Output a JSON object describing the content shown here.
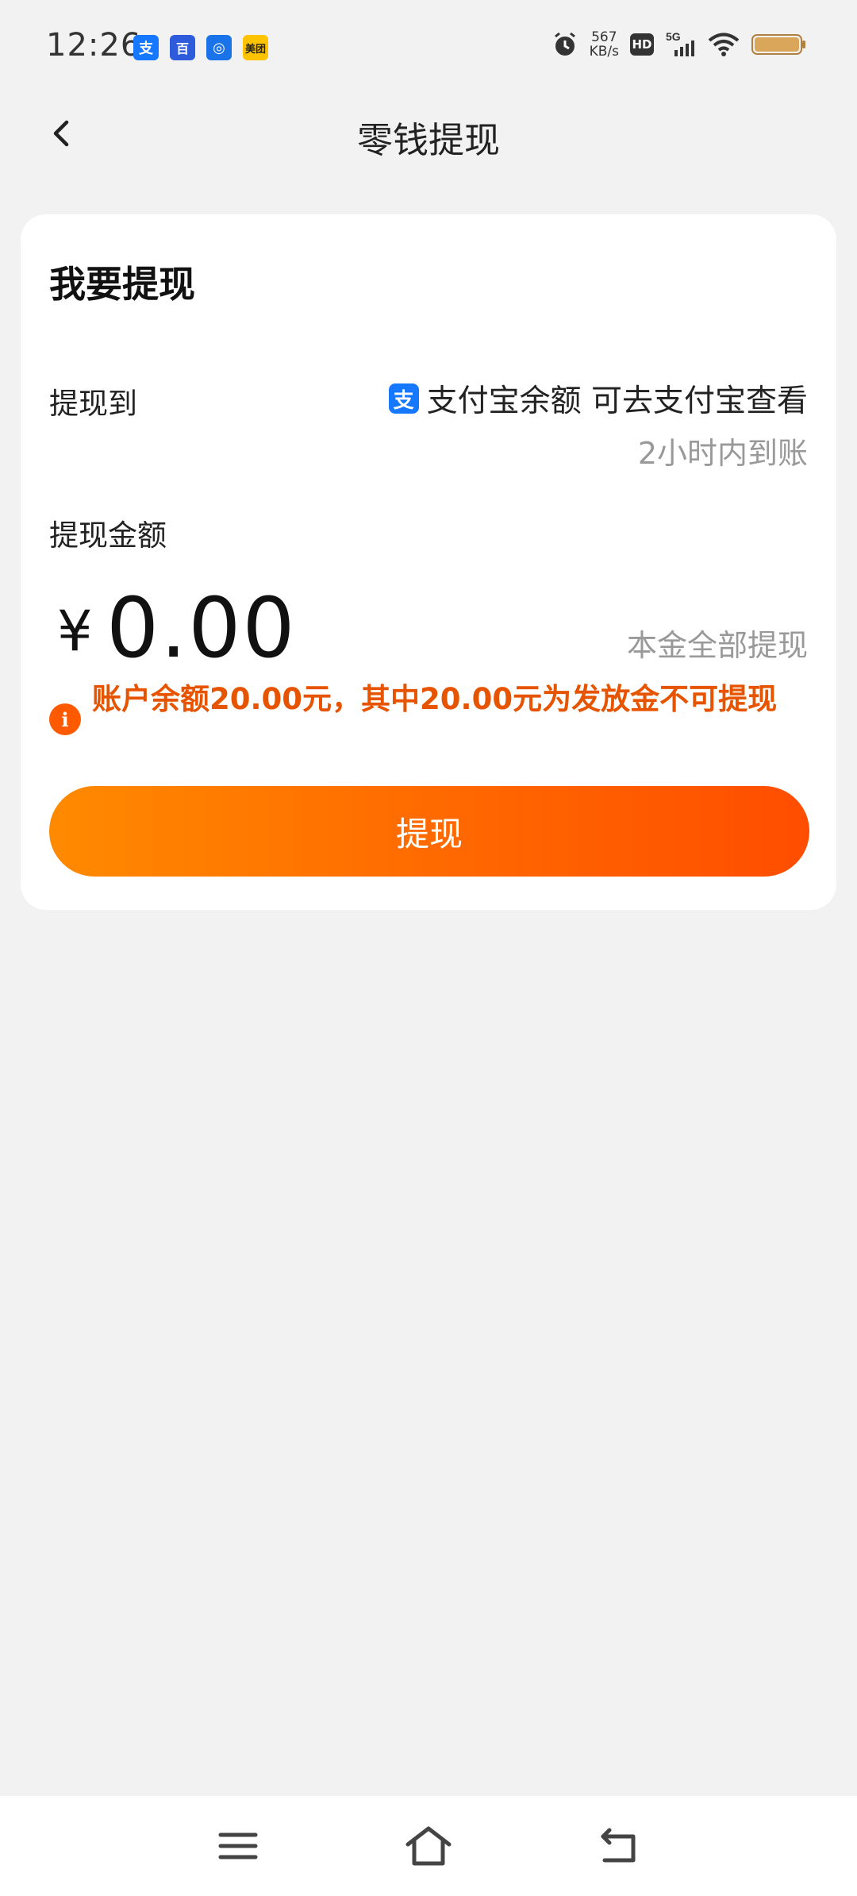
{
  "status_bar": {
    "time": "12:26",
    "notif_icons": [
      {
        "name": "alipay-notif-icon",
        "glyph": "支",
        "color": "#1677ff"
      },
      {
        "name": "baidu-notif-icon",
        "glyph": "百",
        "color": "#2e5bdc"
      },
      {
        "name": "app-notif-icon",
        "glyph": "◎",
        "color": "#1a73e8"
      },
      {
        "name": "meituan-notif-icon",
        "glyph": "美团",
        "color": "#ffc300"
      }
    ],
    "speed_value": "567",
    "speed_unit": "KB/s",
    "hd": "HD",
    "network": "5G"
  },
  "header": {
    "title": "零钱提现"
  },
  "card": {
    "section_title": "我要提现",
    "withdraw_to_label": "提现到",
    "destination": "支付宝余额 可去支付宝查看",
    "alipay_glyph": "支",
    "arrival_time": "2小时内到账",
    "amount_label": "提现金额",
    "currency_symbol": "¥",
    "amount_value": "0.00",
    "withdraw_all": "本金全部提现",
    "warning": "账户余额20.00元，其中20.00元为发放金不可提现",
    "submit_label": "提现"
  },
  "colors": {
    "accent_start": "#ff8a00",
    "accent_end": "#ff4d00",
    "warning_text": "#e65400",
    "alipay_blue": "#1677ff"
  }
}
